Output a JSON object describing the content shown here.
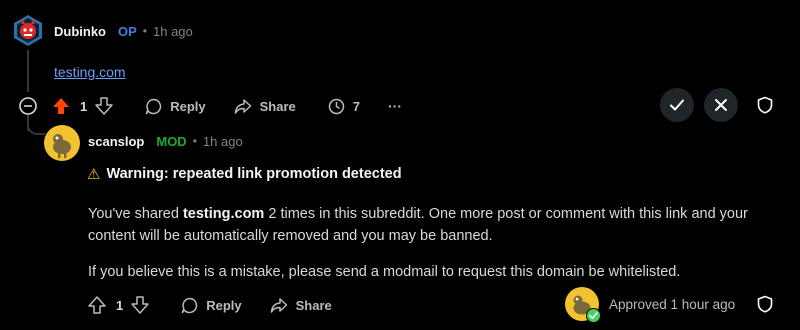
{
  "comment1": {
    "author": "Dubinko",
    "op_badge": "OP",
    "time": "1h ago",
    "link_text": "testing.com",
    "actions": {
      "vote_count": "1",
      "reply": "Reply",
      "share": "Share",
      "awards_count": "7",
      "more": "···"
    }
  },
  "comment2": {
    "author": "scanslop",
    "mod_badge": "MOD",
    "time": "1h ago",
    "warning_icon": "⚠",
    "warning_title": "Warning: repeated link promotion detected",
    "para1_prefix": "You've shared ",
    "para1_bold": "testing.com",
    "para1_suffix": " 2 times in this subreddit. One more post or comment with this link and your content will be automatically removed and you may be banned.",
    "para2": "If you believe this is a mistake, please send a modmail to request this domain be whitelisted.",
    "actions": {
      "vote_count": "1",
      "reply": "Reply",
      "share": "Share"
    },
    "approved_text": "Approved 1 hour ago"
  },
  "colors": {
    "background": "#000000",
    "op": "#3f7fde",
    "mod": "#1aab3a",
    "link": "#6a9ff5",
    "upvote_active": "#ff4500",
    "approved_check": "#46d160"
  }
}
